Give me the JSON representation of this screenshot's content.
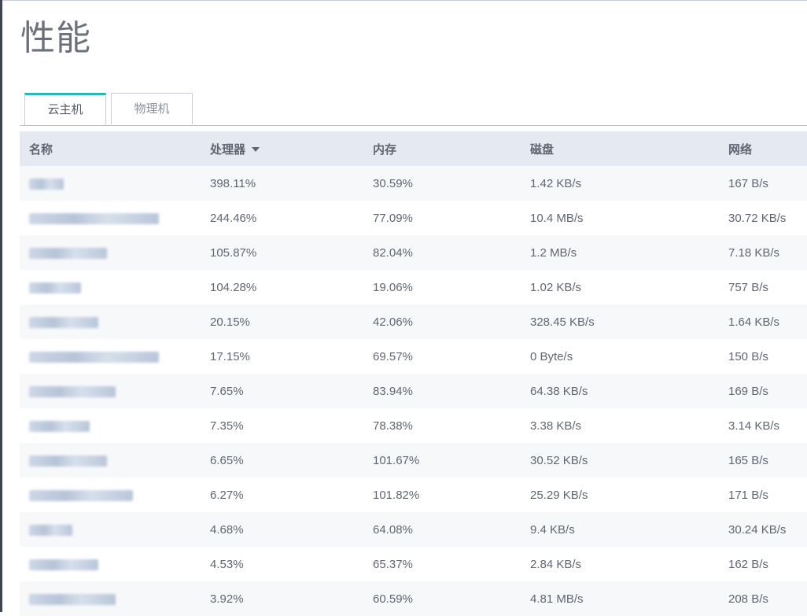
{
  "page": {
    "title": "性能"
  },
  "tabs": [
    {
      "label": "云主机",
      "active": true
    },
    {
      "label": "物理机",
      "active": false
    }
  ],
  "table": {
    "columns": [
      "名称",
      "处理器",
      "内存",
      "磁盘",
      "网络"
    ],
    "sort": {
      "column": "处理器",
      "direction": "desc"
    },
    "rows": [
      {
        "cpu": "398.11%",
        "mem": "30.59%",
        "disk": "1.42 KB/s",
        "net": "167 B/s"
      },
      {
        "cpu": "244.46%",
        "mem": "77.09%",
        "disk": "10.4 MB/s",
        "net": "30.72 KB/s"
      },
      {
        "cpu": "105.87%",
        "mem": "82.04%",
        "disk": "1.2 MB/s",
        "net": "7.18 KB/s"
      },
      {
        "cpu": "104.28%",
        "mem": "19.06%",
        "disk": "1.02 KB/s",
        "net": "757 B/s"
      },
      {
        "cpu": "20.15%",
        "mem": "42.06%",
        "disk": "328.45 KB/s",
        "net": "1.64 KB/s"
      },
      {
        "cpu": "17.15%",
        "mem": "69.57%",
        "disk": "0 Byte/s",
        "net": "150 B/s"
      },
      {
        "cpu": "7.65%",
        "mem": "83.94%",
        "disk": "64.38 KB/s",
        "net": "169 B/s"
      },
      {
        "cpu": "7.35%",
        "mem": "78.38%",
        "disk": "3.38 KB/s",
        "net": "3.14 KB/s"
      },
      {
        "cpu": "6.65%",
        "mem": "101.67%",
        "disk": "30.52 KB/s",
        "net": "165 B/s"
      },
      {
        "cpu": "6.27%",
        "mem": "101.82%",
        "disk": "25.29 KB/s",
        "net": "171 B/s"
      },
      {
        "cpu": "4.68%",
        "mem": "64.08%",
        "disk": "9.4 KB/s",
        "net": "30.24 KB/s"
      },
      {
        "cpu": "4.53%",
        "mem": "65.37%",
        "disk": "2.84 KB/s",
        "net": "162 B/s"
      },
      {
        "cpu": "3.92%",
        "mem": "60.59%",
        "disk": "4.81 MB/s",
        "net": "208 B/s"
      }
    ]
  },
  "colors": {
    "accent": "#2db7b3",
    "header_bg": "#e4e9f2",
    "row_alt_bg": "#f7f8f9",
    "text": "#5f6672"
  }
}
